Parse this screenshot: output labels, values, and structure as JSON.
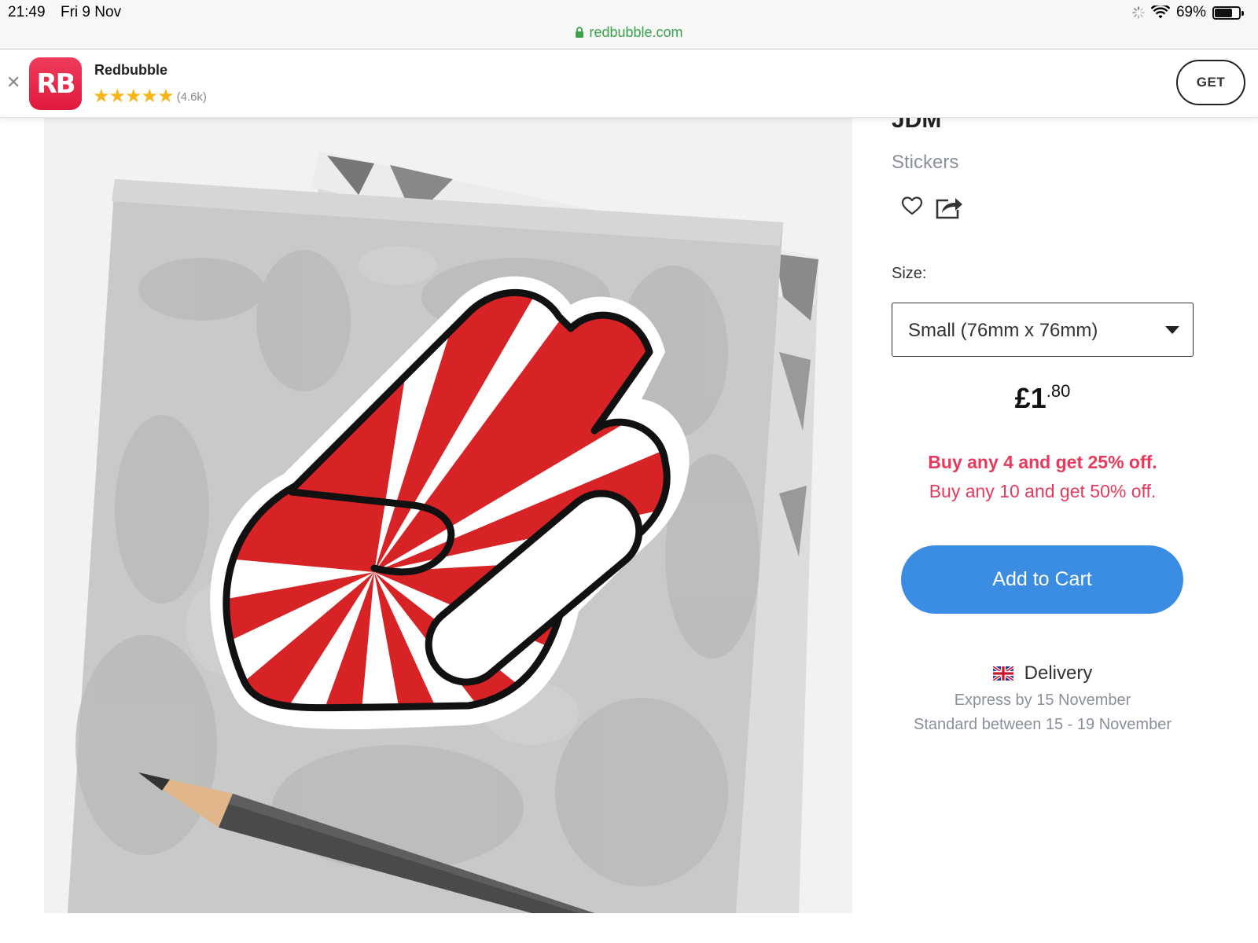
{
  "status_bar": {
    "time": "21:49",
    "date": "Fri 9 Nov",
    "battery": "69%",
    "url": "redbubble.com"
  },
  "app_banner": {
    "icon_text": "RB",
    "name": "Redbubble",
    "stars": "★★★★★",
    "reviews": "(4.6k)",
    "get_label": "GET"
  },
  "product": {
    "title": "JDM",
    "category": "Stickers",
    "size_label": "Size:",
    "size_value": "Small (76mm x 76mm)",
    "price_main": "£1",
    "price_pence": ".80",
    "promo_1": "Buy any 4 and get 25% off.",
    "promo_2": "Buy any 10 and get 50% off.",
    "cart_label": "Add to Cart"
  },
  "delivery": {
    "label": "Delivery",
    "express": "Express by 15 November",
    "standard": "Standard between 15 - 19 November"
  },
  "colors": {
    "accent_red": "#e8395c",
    "cart_blue": "#3b8de4",
    "url_green": "#3aa14d",
    "sticker_red": "#d72226"
  }
}
